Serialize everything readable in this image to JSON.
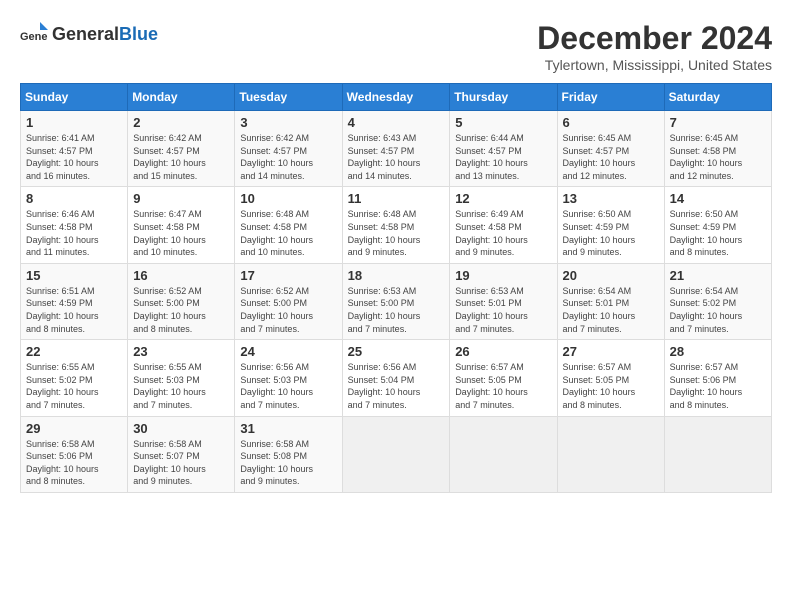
{
  "header": {
    "logo_general": "General",
    "logo_blue": "Blue",
    "month": "December 2024",
    "location": "Tylertown, Mississippi, United States"
  },
  "days_of_week": [
    "Sunday",
    "Monday",
    "Tuesday",
    "Wednesday",
    "Thursday",
    "Friday",
    "Saturday"
  ],
  "weeks": [
    [
      {
        "day": "1",
        "info": "Sunrise: 6:41 AM\nSunset: 4:57 PM\nDaylight: 10 hours\nand 16 minutes."
      },
      {
        "day": "2",
        "info": "Sunrise: 6:42 AM\nSunset: 4:57 PM\nDaylight: 10 hours\nand 15 minutes."
      },
      {
        "day": "3",
        "info": "Sunrise: 6:42 AM\nSunset: 4:57 PM\nDaylight: 10 hours\nand 14 minutes."
      },
      {
        "day": "4",
        "info": "Sunrise: 6:43 AM\nSunset: 4:57 PM\nDaylight: 10 hours\nand 14 minutes."
      },
      {
        "day": "5",
        "info": "Sunrise: 6:44 AM\nSunset: 4:57 PM\nDaylight: 10 hours\nand 13 minutes."
      },
      {
        "day": "6",
        "info": "Sunrise: 6:45 AM\nSunset: 4:57 PM\nDaylight: 10 hours\nand 12 minutes."
      },
      {
        "day": "7",
        "info": "Sunrise: 6:45 AM\nSunset: 4:58 PM\nDaylight: 10 hours\nand 12 minutes."
      }
    ],
    [
      {
        "day": "8",
        "info": "Sunrise: 6:46 AM\nSunset: 4:58 PM\nDaylight: 10 hours\nand 11 minutes."
      },
      {
        "day": "9",
        "info": "Sunrise: 6:47 AM\nSunset: 4:58 PM\nDaylight: 10 hours\nand 10 minutes."
      },
      {
        "day": "10",
        "info": "Sunrise: 6:48 AM\nSunset: 4:58 PM\nDaylight: 10 hours\nand 10 minutes."
      },
      {
        "day": "11",
        "info": "Sunrise: 6:48 AM\nSunset: 4:58 PM\nDaylight: 10 hours\nand 9 minutes."
      },
      {
        "day": "12",
        "info": "Sunrise: 6:49 AM\nSunset: 4:58 PM\nDaylight: 10 hours\nand 9 minutes."
      },
      {
        "day": "13",
        "info": "Sunrise: 6:50 AM\nSunset: 4:59 PM\nDaylight: 10 hours\nand 9 minutes."
      },
      {
        "day": "14",
        "info": "Sunrise: 6:50 AM\nSunset: 4:59 PM\nDaylight: 10 hours\nand 8 minutes."
      }
    ],
    [
      {
        "day": "15",
        "info": "Sunrise: 6:51 AM\nSunset: 4:59 PM\nDaylight: 10 hours\nand 8 minutes."
      },
      {
        "day": "16",
        "info": "Sunrise: 6:52 AM\nSunset: 5:00 PM\nDaylight: 10 hours\nand 8 minutes."
      },
      {
        "day": "17",
        "info": "Sunrise: 6:52 AM\nSunset: 5:00 PM\nDaylight: 10 hours\nand 7 minutes."
      },
      {
        "day": "18",
        "info": "Sunrise: 6:53 AM\nSunset: 5:00 PM\nDaylight: 10 hours\nand 7 minutes."
      },
      {
        "day": "19",
        "info": "Sunrise: 6:53 AM\nSunset: 5:01 PM\nDaylight: 10 hours\nand 7 minutes."
      },
      {
        "day": "20",
        "info": "Sunrise: 6:54 AM\nSunset: 5:01 PM\nDaylight: 10 hours\nand 7 minutes."
      },
      {
        "day": "21",
        "info": "Sunrise: 6:54 AM\nSunset: 5:02 PM\nDaylight: 10 hours\nand 7 minutes."
      }
    ],
    [
      {
        "day": "22",
        "info": "Sunrise: 6:55 AM\nSunset: 5:02 PM\nDaylight: 10 hours\nand 7 minutes."
      },
      {
        "day": "23",
        "info": "Sunrise: 6:55 AM\nSunset: 5:03 PM\nDaylight: 10 hours\nand 7 minutes."
      },
      {
        "day": "24",
        "info": "Sunrise: 6:56 AM\nSunset: 5:03 PM\nDaylight: 10 hours\nand 7 minutes."
      },
      {
        "day": "25",
        "info": "Sunrise: 6:56 AM\nSunset: 5:04 PM\nDaylight: 10 hours\nand 7 minutes."
      },
      {
        "day": "26",
        "info": "Sunrise: 6:57 AM\nSunset: 5:05 PM\nDaylight: 10 hours\nand 7 minutes."
      },
      {
        "day": "27",
        "info": "Sunrise: 6:57 AM\nSunset: 5:05 PM\nDaylight: 10 hours\nand 8 minutes."
      },
      {
        "day": "28",
        "info": "Sunrise: 6:57 AM\nSunset: 5:06 PM\nDaylight: 10 hours\nand 8 minutes."
      }
    ],
    [
      {
        "day": "29",
        "info": "Sunrise: 6:58 AM\nSunset: 5:06 PM\nDaylight: 10 hours\nand 8 minutes."
      },
      {
        "day": "30",
        "info": "Sunrise: 6:58 AM\nSunset: 5:07 PM\nDaylight: 10 hours\nand 9 minutes."
      },
      {
        "day": "31",
        "info": "Sunrise: 6:58 AM\nSunset: 5:08 PM\nDaylight: 10 hours\nand 9 minutes."
      },
      null,
      null,
      null,
      null
    ]
  ]
}
